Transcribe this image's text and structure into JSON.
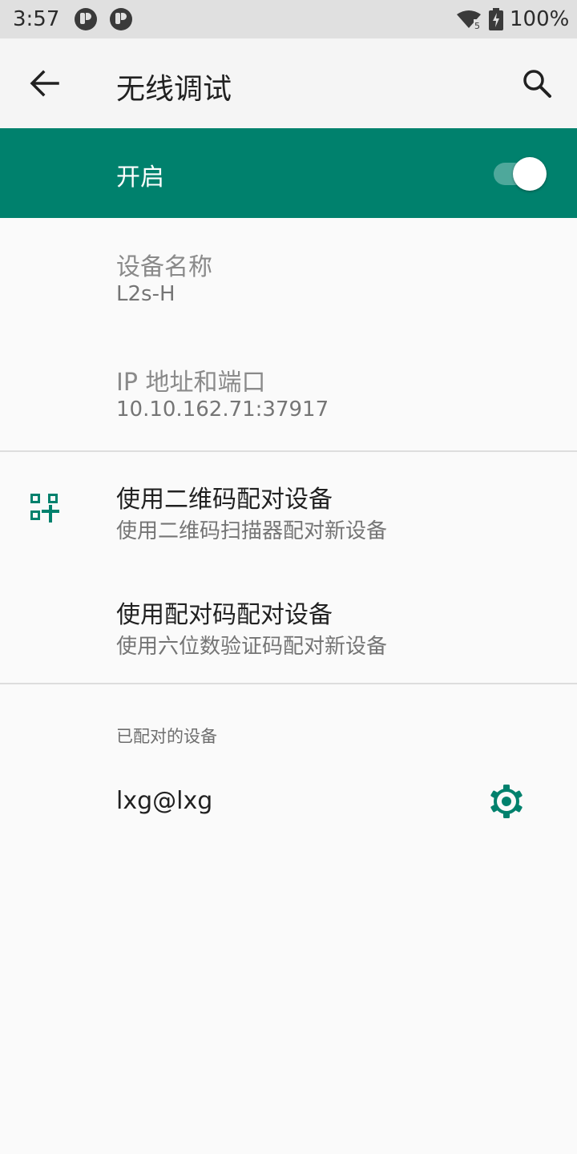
{
  "status_bar": {
    "time": "3:57",
    "battery": "100%",
    "icons": [
      "notification-icon",
      "notification-icon",
      "wifi-icon",
      "battery-charging-icon"
    ]
  },
  "app_bar": {
    "title": "无线调试",
    "back_icon": "arrow-back-icon",
    "search_icon": "search-icon"
  },
  "main_switch": {
    "label": "开启",
    "checked": true
  },
  "device_name": {
    "title": "设备名称",
    "value": "L2s-H"
  },
  "ip_port": {
    "title": "IP 地址和端口",
    "value": "10.10.162.71:37917"
  },
  "pair_qr": {
    "title": "使用二维码配对设备",
    "summary": "使用二维码扫描器配对新设备",
    "icon": "qr-code-scanner-icon"
  },
  "pair_code": {
    "title": "使用配对码配对设备",
    "summary": "使用六位数验证码配对新设备"
  },
  "paired_devices": {
    "header": "已配对的设备",
    "items": [
      {
        "name": "lxg@lxg",
        "icon": "gear-icon"
      }
    ]
  },
  "colors": {
    "accent": "#00816d",
    "status_bar_bg": "#e0e0e0",
    "app_bar_bg": "#f5f5f5",
    "background": "#fafafa"
  }
}
